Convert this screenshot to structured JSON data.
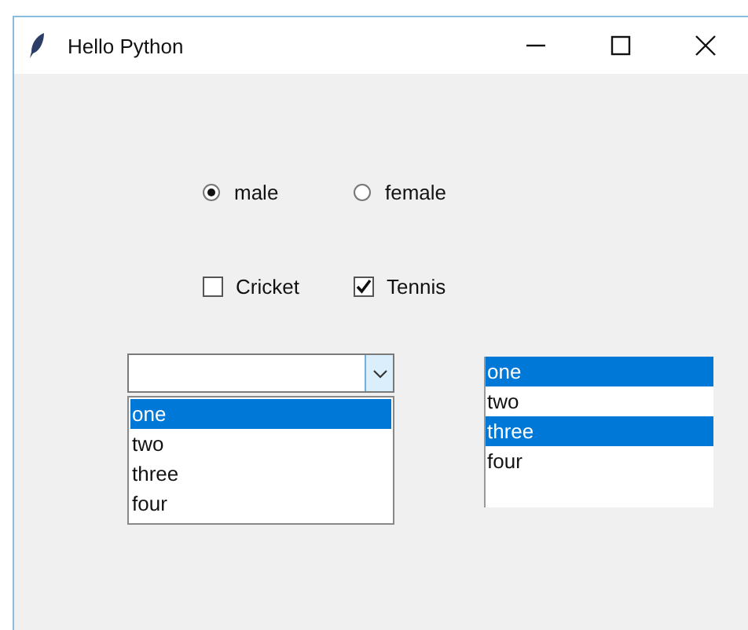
{
  "window": {
    "title": "Hello Python"
  },
  "radios": [
    {
      "label": "male",
      "selected": true
    },
    {
      "label": "female",
      "selected": false
    }
  ],
  "checkboxes": [
    {
      "label": "Cricket",
      "checked": false
    },
    {
      "label": "Tennis",
      "checked": true
    }
  ],
  "combobox": {
    "expanded": true,
    "options": [
      {
        "label": "one",
        "selected": true
      },
      {
        "label": "two",
        "selected": false
      },
      {
        "label": "three",
        "selected": false
      },
      {
        "label": "four",
        "selected": false
      }
    ]
  },
  "listbox": {
    "items": [
      {
        "label": "one",
        "selected": true
      },
      {
        "label": "two",
        "selected": false
      },
      {
        "label": "three",
        "selected": true
      },
      {
        "label": "four",
        "selected": false
      }
    ]
  }
}
